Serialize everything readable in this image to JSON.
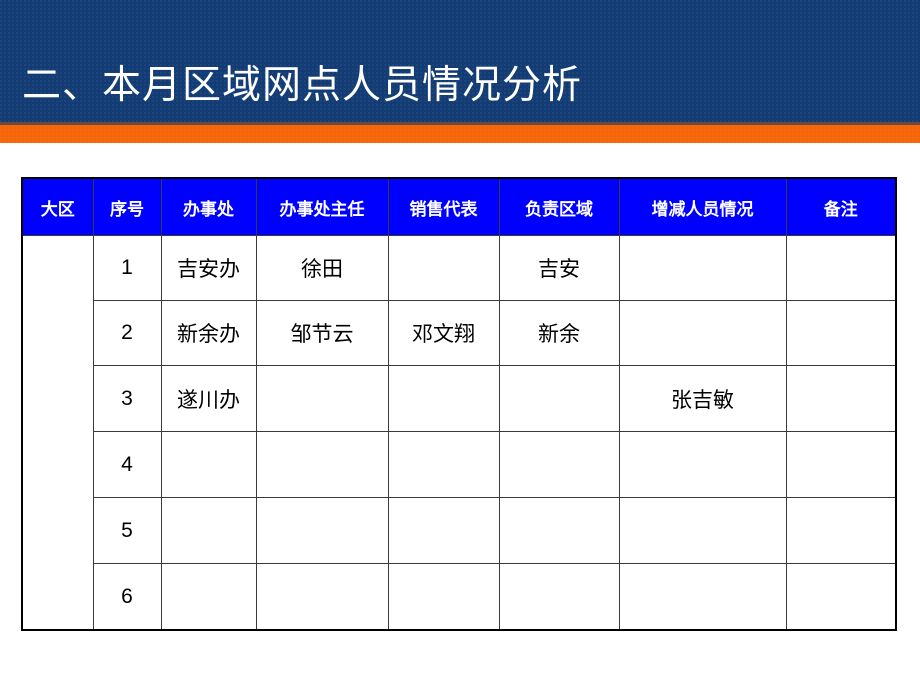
{
  "slide": {
    "title": "二、本月区域网点人员情况分析",
    "colors": {
      "header_background": "#123c73",
      "accent_bar": "#f4650c",
      "table_header_background": "#0000ff",
      "table_header_text": "#ffffff",
      "body_background": "#ffffff",
      "table_border": "#000000"
    }
  },
  "table": {
    "columns": [
      {
        "key": "region",
        "label": "大区"
      },
      {
        "key": "seq",
        "label": "序号"
      },
      {
        "key": "office",
        "label": "办事处"
      },
      {
        "key": "office_head",
        "label": "办事处主任"
      },
      {
        "key": "sales_rep",
        "label": "销售代表"
      },
      {
        "key": "area",
        "label": "负责区域"
      },
      {
        "key": "staff_change",
        "label": "增减人员情况"
      },
      {
        "key": "note",
        "label": "备注"
      }
    ],
    "rows": [
      {
        "region": "",
        "seq": "1",
        "office": "吉安办",
        "office_head": "徐田",
        "sales_rep": "",
        "area": "吉安",
        "staff_change": "",
        "note": ""
      },
      {
        "region": "",
        "seq": "2",
        "office": "新余办",
        "office_head": "邹节云",
        "sales_rep": "邓文翔",
        "area": "新余",
        "staff_change": "",
        "note": ""
      },
      {
        "region": "",
        "seq": "3",
        "office": "遂川办",
        "office_head": "",
        "sales_rep": "",
        "area": "",
        "staff_change": "张吉敏",
        "note": ""
      },
      {
        "region": "",
        "seq": "4",
        "office": "",
        "office_head": "",
        "sales_rep": "",
        "area": "",
        "staff_change": "",
        "note": ""
      },
      {
        "region": "",
        "seq": "5",
        "office": "",
        "office_head": "",
        "sales_rep": "",
        "area": "",
        "staff_change": "",
        "note": ""
      },
      {
        "region": "",
        "seq": "6",
        "office": "",
        "office_head": "",
        "sales_rep": "",
        "area": "",
        "staff_change": "",
        "note": ""
      }
    ]
  }
}
